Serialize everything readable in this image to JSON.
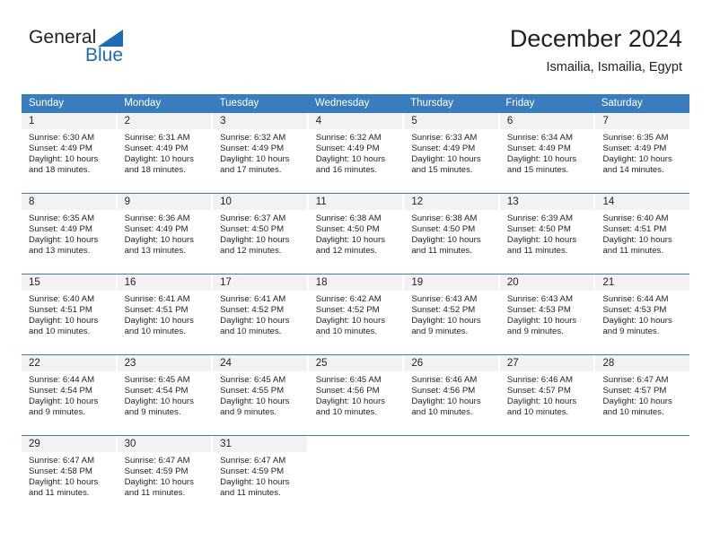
{
  "brand": {
    "name_part1": "General",
    "name_part2": "Blue",
    "accent_color": "#1b6cb5"
  },
  "header": {
    "title": "December 2024",
    "subtitle": "Ismailia, Ismailia, Egypt"
  },
  "calendar": {
    "header_bg": "#3a7dbe",
    "day_num_bg": "#f2f2f2",
    "weekdays": [
      "Sunday",
      "Monday",
      "Tuesday",
      "Wednesday",
      "Thursday",
      "Friday",
      "Saturday"
    ],
    "weeks": [
      [
        {
          "day": "1",
          "sunrise": "Sunrise: 6:30 AM",
          "sunset": "Sunset: 4:49 PM",
          "daylight1": "Daylight: 10 hours",
          "daylight2": "and 18 minutes."
        },
        {
          "day": "2",
          "sunrise": "Sunrise: 6:31 AM",
          "sunset": "Sunset: 4:49 PM",
          "daylight1": "Daylight: 10 hours",
          "daylight2": "and 18 minutes."
        },
        {
          "day": "3",
          "sunrise": "Sunrise: 6:32 AM",
          "sunset": "Sunset: 4:49 PM",
          "daylight1": "Daylight: 10 hours",
          "daylight2": "and 17 minutes."
        },
        {
          "day": "4",
          "sunrise": "Sunrise: 6:32 AM",
          "sunset": "Sunset: 4:49 PM",
          "daylight1": "Daylight: 10 hours",
          "daylight2": "and 16 minutes."
        },
        {
          "day": "5",
          "sunrise": "Sunrise: 6:33 AM",
          "sunset": "Sunset: 4:49 PM",
          "daylight1": "Daylight: 10 hours",
          "daylight2": "and 15 minutes."
        },
        {
          "day": "6",
          "sunrise": "Sunrise: 6:34 AM",
          "sunset": "Sunset: 4:49 PM",
          "daylight1": "Daylight: 10 hours",
          "daylight2": "and 15 minutes."
        },
        {
          "day": "7",
          "sunrise": "Sunrise: 6:35 AM",
          "sunset": "Sunset: 4:49 PM",
          "daylight1": "Daylight: 10 hours",
          "daylight2": "and 14 minutes."
        }
      ],
      [
        {
          "day": "8",
          "sunrise": "Sunrise: 6:35 AM",
          "sunset": "Sunset: 4:49 PM",
          "daylight1": "Daylight: 10 hours",
          "daylight2": "and 13 minutes."
        },
        {
          "day": "9",
          "sunrise": "Sunrise: 6:36 AM",
          "sunset": "Sunset: 4:49 PM",
          "daylight1": "Daylight: 10 hours",
          "daylight2": "and 13 minutes."
        },
        {
          "day": "10",
          "sunrise": "Sunrise: 6:37 AM",
          "sunset": "Sunset: 4:50 PM",
          "daylight1": "Daylight: 10 hours",
          "daylight2": "and 12 minutes."
        },
        {
          "day": "11",
          "sunrise": "Sunrise: 6:38 AM",
          "sunset": "Sunset: 4:50 PM",
          "daylight1": "Daylight: 10 hours",
          "daylight2": "and 12 minutes."
        },
        {
          "day": "12",
          "sunrise": "Sunrise: 6:38 AM",
          "sunset": "Sunset: 4:50 PM",
          "daylight1": "Daylight: 10 hours",
          "daylight2": "and 11 minutes."
        },
        {
          "day": "13",
          "sunrise": "Sunrise: 6:39 AM",
          "sunset": "Sunset: 4:50 PM",
          "daylight1": "Daylight: 10 hours",
          "daylight2": "and 11 minutes."
        },
        {
          "day": "14",
          "sunrise": "Sunrise: 6:40 AM",
          "sunset": "Sunset: 4:51 PM",
          "daylight1": "Daylight: 10 hours",
          "daylight2": "and 11 minutes."
        }
      ],
      [
        {
          "day": "15",
          "sunrise": "Sunrise: 6:40 AM",
          "sunset": "Sunset: 4:51 PM",
          "daylight1": "Daylight: 10 hours",
          "daylight2": "and 10 minutes."
        },
        {
          "day": "16",
          "sunrise": "Sunrise: 6:41 AM",
          "sunset": "Sunset: 4:51 PM",
          "daylight1": "Daylight: 10 hours",
          "daylight2": "and 10 minutes."
        },
        {
          "day": "17",
          "sunrise": "Sunrise: 6:41 AM",
          "sunset": "Sunset: 4:52 PM",
          "daylight1": "Daylight: 10 hours",
          "daylight2": "and 10 minutes."
        },
        {
          "day": "18",
          "sunrise": "Sunrise: 6:42 AM",
          "sunset": "Sunset: 4:52 PM",
          "daylight1": "Daylight: 10 hours",
          "daylight2": "and 10 minutes."
        },
        {
          "day": "19",
          "sunrise": "Sunrise: 6:43 AM",
          "sunset": "Sunset: 4:52 PM",
          "daylight1": "Daylight: 10 hours",
          "daylight2": "and 9 minutes."
        },
        {
          "day": "20",
          "sunrise": "Sunrise: 6:43 AM",
          "sunset": "Sunset: 4:53 PM",
          "daylight1": "Daylight: 10 hours",
          "daylight2": "and 9 minutes."
        },
        {
          "day": "21",
          "sunrise": "Sunrise: 6:44 AM",
          "sunset": "Sunset: 4:53 PM",
          "daylight1": "Daylight: 10 hours",
          "daylight2": "and 9 minutes."
        }
      ],
      [
        {
          "day": "22",
          "sunrise": "Sunrise: 6:44 AM",
          "sunset": "Sunset: 4:54 PM",
          "daylight1": "Daylight: 10 hours",
          "daylight2": "and 9 minutes."
        },
        {
          "day": "23",
          "sunrise": "Sunrise: 6:45 AM",
          "sunset": "Sunset: 4:54 PM",
          "daylight1": "Daylight: 10 hours",
          "daylight2": "and 9 minutes."
        },
        {
          "day": "24",
          "sunrise": "Sunrise: 6:45 AM",
          "sunset": "Sunset: 4:55 PM",
          "daylight1": "Daylight: 10 hours",
          "daylight2": "and 9 minutes."
        },
        {
          "day": "25",
          "sunrise": "Sunrise: 6:45 AM",
          "sunset": "Sunset: 4:56 PM",
          "daylight1": "Daylight: 10 hours",
          "daylight2": "and 10 minutes."
        },
        {
          "day": "26",
          "sunrise": "Sunrise: 6:46 AM",
          "sunset": "Sunset: 4:56 PM",
          "daylight1": "Daylight: 10 hours",
          "daylight2": "and 10 minutes."
        },
        {
          "day": "27",
          "sunrise": "Sunrise: 6:46 AM",
          "sunset": "Sunset: 4:57 PM",
          "daylight1": "Daylight: 10 hours",
          "daylight2": "and 10 minutes."
        },
        {
          "day": "28",
          "sunrise": "Sunrise: 6:47 AM",
          "sunset": "Sunset: 4:57 PM",
          "daylight1": "Daylight: 10 hours",
          "daylight2": "and 10 minutes."
        }
      ],
      [
        {
          "day": "29",
          "sunrise": "Sunrise: 6:47 AM",
          "sunset": "Sunset: 4:58 PM",
          "daylight1": "Daylight: 10 hours",
          "daylight2": "and 11 minutes."
        },
        {
          "day": "30",
          "sunrise": "Sunrise: 6:47 AM",
          "sunset": "Sunset: 4:59 PM",
          "daylight1": "Daylight: 10 hours",
          "daylight2": "and 11 minutes."
        },
        {
          "day": "31",
          "sunrise": "Sunrise: 6:47 AM",
          "sunset": "Sunset: 4:59 PM",
          "daylight1": "Daylight: 10 hours",
          "daylight2": "and 11 minutes."
        },
        {
          "day": "",
          "sunrise": "",
          "sunset": "",
          "daylight1": "",
          "daylight2": ""
        },
        {
          "day": "",
          "sunrise": "",
          "sunset": "",
          "daylight1": "",
          "daylight2": ""
        },
        {
          "day": "",
          "sunrise": "",
          "sunset": "",
          "daylight1": "",
          "daylight2": ""
        },
        {
          "day": "",
          "sunrise": "",
          "sunset": "",
          "daylight1": "",
          "daylight2": ""
        }
      ]
    ]
  }
}
